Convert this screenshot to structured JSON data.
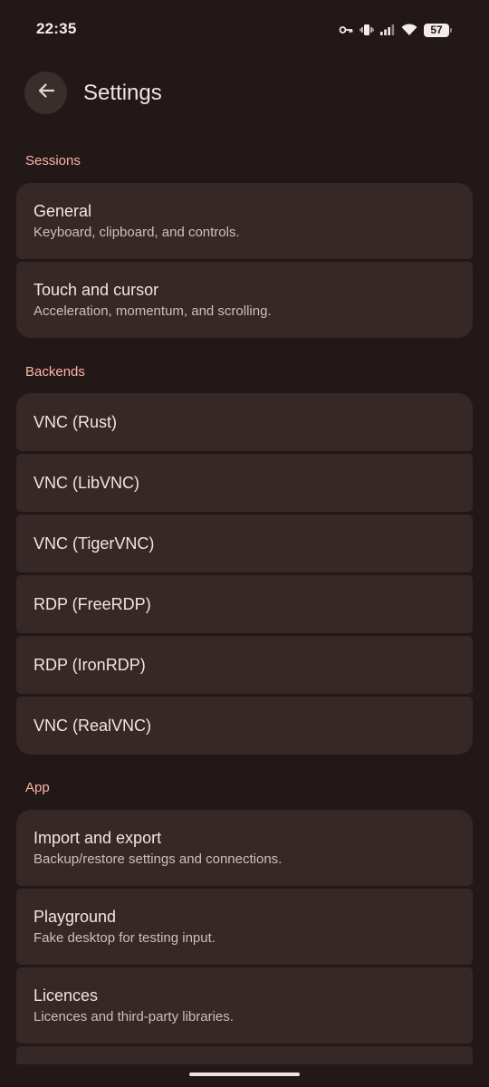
{
  "status_bar": {
    "time": "22:35",
    "battery": "57"
  },
  "app_bar": {
    "title": "Settings"
  },
  "sections": {
    "sessions": {
      "header": "Sessions",
      "items": [
        {
          "title": "General",
          "subtitle": "Keyboard, clipboard, and controls."
        },
        {
          "title": "Touch and cursor",
          "subtitle": "Acceleration, momentum, and scrolling."
        }
      ]
    },
    "backends": {
      "header": "Backends",
      "items": [
        {
          "title": "VNC (Rust)"
        },
        {
          "title": "VNC (LibVNC)"
        },
        {
          "title": "VNC (TigerVNC)"
        },
        {
          "title": "RDP (FreeRDP)"
        },
        {
          "title": "RDP (IronRDP)"
        },
        {
          "title": "VNC (RealVNC)"
        }
      ]
    },
    "app": {
      "header": "App",
      "items": [
        {
          "title": "Import and export",
          "subtitle": "Backup/restore settings and connections."
        },
        {
          "title": "Playground",
          "subtitle": "Fake desktop for testing input."
        },
        {
          "title": "Licences",
          "subtitle": "Licences and third-party libraries."
        }
      ]
    }
  },
  "colors": {
    "background": "#211817",
    "surface": "#352827",
    "section_header": "#ffb4a8",
    "primary_text": "#f1e4e2",
    "secondary_text": "#cfbebc"
  },
  "icons": {
    "back": "arrow-back-icon",
    "status": [
      "vpn-key-icon",
      "vibrate-icon",
      "signal-icon",
      "wifi-icon",
      "battery-icon"
    ]
  }
}
